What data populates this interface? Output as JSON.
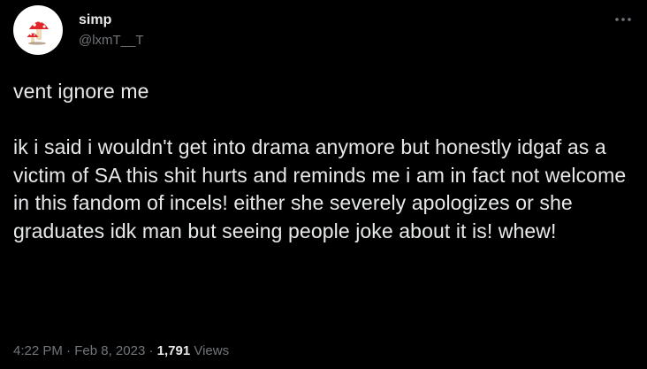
{
  "author": {
    "display_name": "simp",
    "handle": "@lxmT__T",
    "avatar_icon": "mushroom-icon"
  },
  "menu": {
    "more_icon": "more-options-icon"
  },
  "tweet": {
    "text": "vent ignore me\n\nik i said i wouldn't get into drama anymore but honestly idgaf as a victim of SA this shit hurts and reminds me i am in fact not welcome in this fandom of incels! either she severely apologizes or she graduates idk man but seeing people joke about it is! whew!"
  },
  "meta": {
    "time": "4:22 PM",
    "separator": " · ",
    "date": "Feb 8, 2023",
    "views_count": "1,791",
    "views_label": " Views"
  },
  "colors": {
    "background": "#000000",
    "text_primary": "#e7e9ea",
    "text_secondary": "#71767b",
    "mushroom_cap": "#e0262b",
    "mushroom_spots": "#ffffff",
    "mushroom_stem": "#f1d9b8"
  }
}
